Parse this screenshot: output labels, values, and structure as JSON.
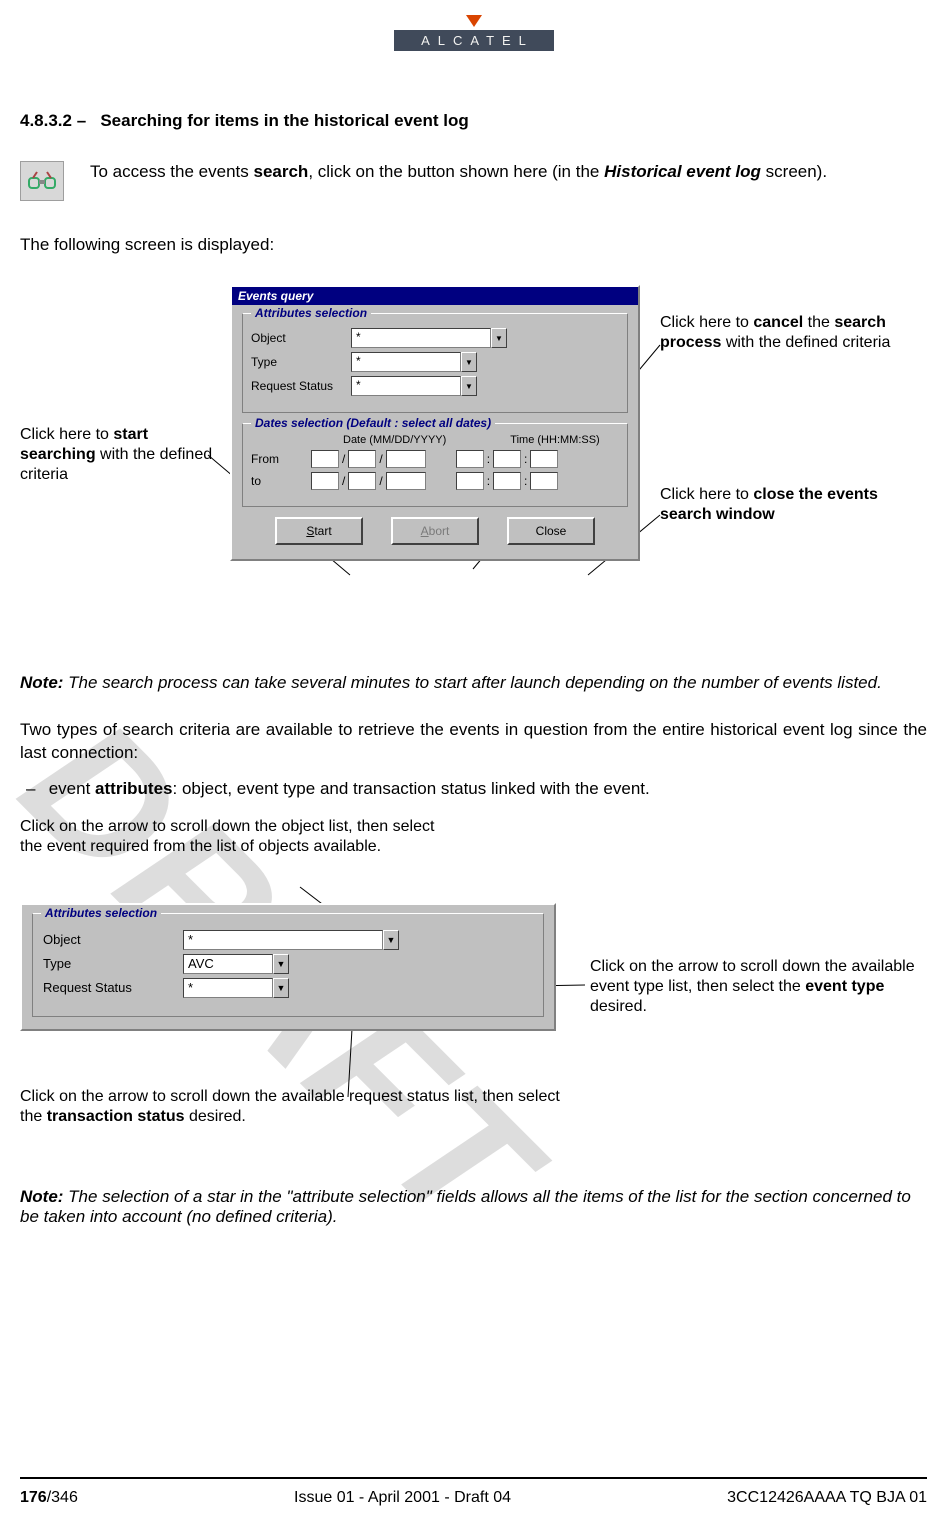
{
  "brand": "ALCATEL",
  "section_number": "4.8.3.2 –",
  "section_title": "Searching for items in the historical event log",
  "intro_prefix": "To access the events ",
  "intro_bold1": "search",
  "intro_mid": ", click on the button shown here (in the ",
  "intro_bolditalic": "Historical event log",
  "intro_suffix": " screen).",
  "following": "The following screen is displayed:",
  "dialog": {
    "title": "Events query",
    "grp1_title": "Attributes selection",
    "labels": {
      "object": "Object",
      "type": "Type",
      "request": "Request Status"
    },
    "star": "*",
    "grp2_title": "Dates selection   (Default : select all dates)",
    "date_col": "Date (MM/DD/YYYY)",
    "time_col": "Time (HH:MM:SS)",
    "from": "From",
    "to": "to",
    "buttons": {
      "start": "Start",
      "abort": "Abort",
      "close": "Close"
    }
  },
  "callouts": {
    "start_a": "Click here to ",
    "start_b": "start searching",
    "start_c": " with the defined criteria",
    "cancel_a": "Click here to ",
    "cancel_b": "cancel",
    "cancel_c": " the ",
    "cancel_d": "search process",
    "cancel_e": " with the defined criteria",
    "close_a": "Click here to ",
    "close_b": "close the events search window"
  },
  "note1_lead": "Note:",
  "note1_body": " The search process can take several minutes to start after launch depending on the number of events listed.",
  "twotypes": "Two types of search criteria are available to retrieve the events in question from the entire historical event log since the last connection:",
  "bullet_dash": "–",
  "bullet_pre": " event ",
  "bullet_bold": "attributes",
  "bullet_post": ": object, event type and transaction status linked with the event.",
  "attr_callouts": {
    "obj": "Click on the arrow to scroll down the object list, then select the event required from the list of objects available.",
    "type_a": "Click on the arrow to scroll down the available event type list, then select the ",
    "type_b": "event type",
    "type_c": " desired.",
    "req_a": "Click on the arrow to scroll down the available request status list, then select the ",
    "req_b": "transaction status",
    "req_c": " desired."
  },
  "attrpanel": {
    "title": "Attributes selection",
    "object": "Object",
    "type": "Type",
    "request": "Request Status",
    "object_val": "*",
    "type_val": "AVC",
    "request_val": "*"
  },
  "note2_lead": "Note:",
  "note2_body": " The selection of a star in the \"attribute selection\" fields allows all the items of the list for the section concerned to be taken into account (no defined criteria).",
  "footer": {
    "page_bold": "176",
    "page_rest": "/346",
    "center": "Issue 01 - April 2001 - Draft 04",
    "right": "3CC12426AAAA TQ BJA 01"
  },
  "watermark": "DRAFT"
}
